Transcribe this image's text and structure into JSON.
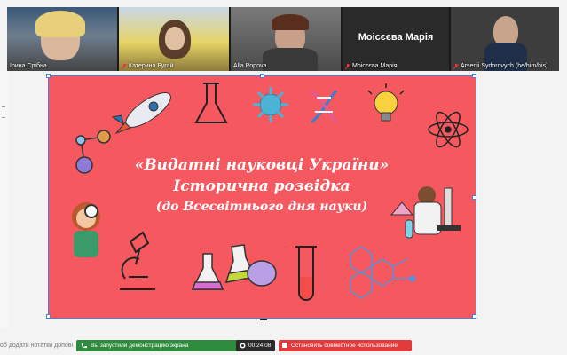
{
  "participants": [
    {
      "name": "Ірина Срібна",
      "muted": false
    },
    {
      "name": "Катерина Бугай",
      "muted": true
    },
    {
      "name": "Alla Popova",
      "muted": false
    },
    {
      "name": "Моісєєва Марія",
      "muted": true,
      "display": "Моісєєва Марія"
    },
    {
      "name": "Arsenii Sydorovych (he/him/his)",
      "muted": true
    }
  ],
  "slide": {
    "line1": "«Видатні науковці України»",
    "line2": "Історична розвідка",
    "line3": "(до Всесвітнього дня науки)",
    "background": "#f65860"
  },
  "notes_hint": "об додати нотатки допові",
  "share": {
    "status": "Вы запустили демонстрацию экрана",
    "timer": "00:24:08",
    "stop_label": "Остановить совместное использование"
  },
  "colors": {
    "share_green": "#2e8b3d",
    "stop_red": "#e23b3b",
    "selection_blue": "#4a7fd8"
  }
}
